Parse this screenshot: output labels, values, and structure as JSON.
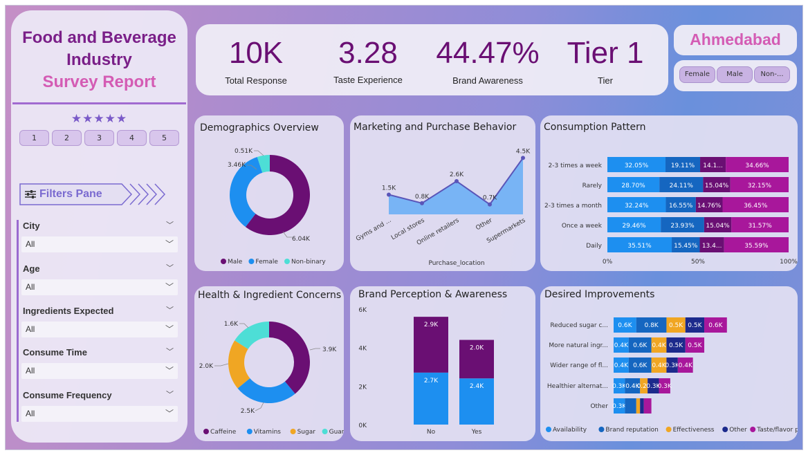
{
  "sidebar": {
    "title_line1": "Food and Beverage",
    "title_line2": "Industry",
    "title_line3": "Survey Report",
    "stars": "★★★★★",
    "rating_buttons": [
      "1",
      "2",
      "3",
      "4",
      "5"
    ],
    "filters_pane_label": "Filters Pane",
    "filters": [
      {
        "label": "City",
        "value": "All"
      },
      {
        "label": "Age",
        "value": "All"
      },
      {
        "label": "Ingredients Expected",
        "value": "All"
      },
      {
        "label": "Consume Time",
        "value": "All"
      },
      {
        "label": "Consume Frequency",
        "value": "All"
      }
    ]
  },
  "kpis": [
    {
      "value": "10K",
      "label": "Total Response"
    },
    {
      "value": "3.28",
      "label": "Taste Experience"
    },
    {
      "value": "44.47%",
      "label": "Brand Awareness"
    },
    {
      "value": "Tier 1",
      "label": "Tier"
    }
  ],
  "city": {
    "name": "Ahmedabad"
  },
  "gender_buttons": [
    "Female",
    "Male",
    "Non-..."
  ],
  "colors": {
    "purple": "#6a0f73",
    "blue": "#1d8ff0",
    "cyan": "#4dded6",
    "orange": "#f0a623",
    "navy": "#1c2a8c",
    "magenta": "#a8179b",
    "mid_blue": "#1566c0",
    "light_blue": "#78b4f5"
  },
  "chart_data": [
    {
      "id": "demographics",
      "type": "pie",
      "title": "Demographics Overview",
      "labels": [
        "Male",
        "Female",
        "Non-binary"
      ],
      "values": [
        6.04,
        3.46,
        0.51
      ],
      "data_labels": [
        "6.04K",
        "3.46K",
        "0.51K"
      ],
      "colors": [
        "#6a0f73",
        "#1d8ff0",
        "#4dded6"
      ],
      "donut": true
    },
    {
      "id": "marketing",
      "type": "area",
      "title": "Marketing and Purchase Behavior",
      "categories": [
        "Gyms and ...",
        "Local stores",
        "Online retailers",
        "Other",
        "Supermarkets"
      ],
      "values": [
        1.5,
        0.8,
        2.6,
        0.7,
        4.5
      ],
      "data_labels": [
        "1.5K",
        "0.8K",
        "2.6K",
        "0.7K",
        "4.5K"
      ],
      "xlabel": "Purchase_location"
    },
    {
      "id": "consumption",
      "type": "bar",
      "title": "Consumption Pattern",
      "stacked_percent": true,
      "categories": [
        "2-3 times a week",
        "Rarely",
        "2-3 times a month",
        "Once a week",
        "Daily"
      ],
      "series": [
        {
          "values": [
            32.05,
            28.7,
            32.24,
            29.46,
            35.51
          ],
          "labels": [
            "32.05%",
            "28.70%",
            "32.24%",
            "29.46%",
            "35.51%"
          ],
          "color": "#1d8ff0"
        },
        {
          "values": [
            19.11,
            24.11,
            16.55,
            23.93,
            15.45
          ],
          "labels": [
            "19.11%",
            "24.11%",
            "16.55%",
            "23.93%",
            "15.45%"
          ],
          "color": "#1566c0"
        },
        {
          "values": [
            14.18,
            15.04,
            14.76,
            15.04,
            13.45
          ],
          "labels": [
            "14.1...",
            "15.04%",
            "14.76%",
            "15.04%",
            "13.4..."
          ],
          "color": "#6a0f73"
        },
        {
          "values": [
            34.66,
            32.15,
            36.45,
            31.57,
            35.59
          ],
          "labels": [
            "34.66%",
            "32.15%",
            "36.45%",
            "31.57%",
            "35.59%"
          ],
          "color": "#a8179b"
        }
      ],
      "xticks": [
        "0%",
        "50%",
        "100%"
      ]
    },
    {
      "id": "health",
      "type": "pie",
      "title": "Health & Ingredient Concerns",
      "labels": [
        "Caffeine",
        "Vitamins",
        "Sugar",
        "Guarana"
      ],
      "values": [
        3.9,
        2.5,
        2.0,
        1.6
      ],
      "data_labels": [
        "3.9K",
        "2.5K",
        "2.0K",
        "1.6K"
      ],
      "colors": [
        "#6a0f73",
        "#1d8ff0",
        "#f0a623",
        "#4dded6"
      ],
      "donut": true
    },
    {
      "id": "brand",
      "type": "bar",
      "title": "Brand Perception & Awareness",
      "stacked": true,
      "categories": [
        "No",
        "Yes"
      ],
      "series": [
        {
          "values": [
            2.7,
            2.4
          ],
          "labels": [
            "2.7K",
            "2.4K"
          ],
          "color": "#1d8ff0"
        },
        {
          "values": [
            2.9,
            2.0
          ],
          "labels": [
            "2.9K",
            "2.0K"
          ],
          "color": "#6a0f73"
        }
      ],
      "yticks": [
        "0K",
        "2K",
        "4K",
        "6K"
      ],
      "ylim": [
        0,
        6
      ]
    },
    {
      "id": "improvements",
      "type": "bar",
      "title": "Desired Improvements",
      "stacked": true,
      "categories": [
        "Reduced sugar c...",
        "More natural ingr...",
        "Wider range of fl...",
        "Healthier alternat...",
        "Other"
      ],
      "series": [
        {
          "name": "Availability",
          "values": [
            0.6,
            0.4,
            0.4,
            0.3,
            0.3
          ],
          "labels": [
            "0.6K",
            "0.4K",
            "0.4K",
            "0.3K",
            "0.3K"
          ],
          "color": "#1d8ff0"
        },
        {
          "name": "Brand reputation",
          "values": [
            0.8,
            0.6,
            0.6,
            0.4,
            0.3
          ],
          "labels": [
            "0.8K",
            "0.6K",
            "0.6K",
            "0.4K",
            ""
          ],
          "color": "#1566c0"
        },
        {
          "name": "Effectiveness",
          "values": [
            0.5,
            0.4,
            0.4,
            0.2,
            0.1
          ],
          "labels": [
            "0.5K",
            "0.4K",
            "0.4K",
            "0.2K",
            ""
          ],
          "color": "#f0a623"
        },
        {
          "name": "Other",
          "values": [
            0.5,
            0.5,
            0.3,
            0.3,
            0.1
          ],
          "labels": [
            "0.5K",
            "0.5K",
            "0.3K",
            "0.3K",
            ""
          ],
          "color": "#1c2a8c"
        },
        {
          "name": "Taste/flavor prefere...",
          "values": [
            0.6,
            0.5,
            0.4,
            0.3,
            0.2
          ],
          "labels": [
            "0.6K",
            "0.5K",
            "0.4K",
            "0.3K",
            ""
          ],
          "color": "#a8179b"
        }
      ]
    }
  ]
}
